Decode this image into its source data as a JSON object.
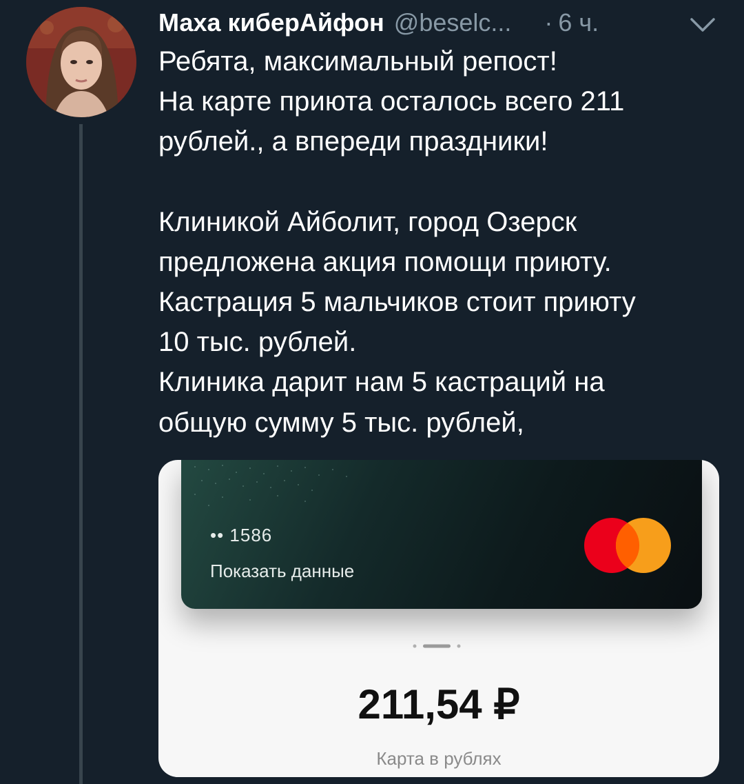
{
  "tweet": {
    "author": {
      "display_name": "Маха киберАйфон",
      "handle": "@beselc...",
      "avatar_icon": "user-avatar"
    },
    "time_separator": "·",
    "time": "6 ч.",
    "menu_icon": "chevron-down-icon",
    "text_lines_1": [
      "Ребята, максимальный репост!",
      "На карте приюта осталось всего 211",
      "рублей., а впереди праздники!"
    ],
    "text_lines_2": [
      "Клиникой Айболит, город Озерск",
      "предложена акция помощи приюту.",
      "Кастрация  5 мальчиков стоит приюту",
      "10 тыс. рублей.",
      "Клиника дарит нам 5 кастраций на",
      "общую сумму 5 тыс. рублей,"
    ]
  },
  "media": {
    "card": {
      "number": "•• 1586",
      "show_details": "Показать данные",
      "brand_icon": "mastercard-logo"
    },
    "balance": "211,54 ₽",
    "caption": "Карта в рублях"
  },
  "colors": {
    "background": "#15202b",
    "secondary_text": "#8899a6",
    "thread_line": "#38444d",
    "mastercard_red": "#eb001b",
    "mastercard_orange": "#f79e1b"
  }
}
